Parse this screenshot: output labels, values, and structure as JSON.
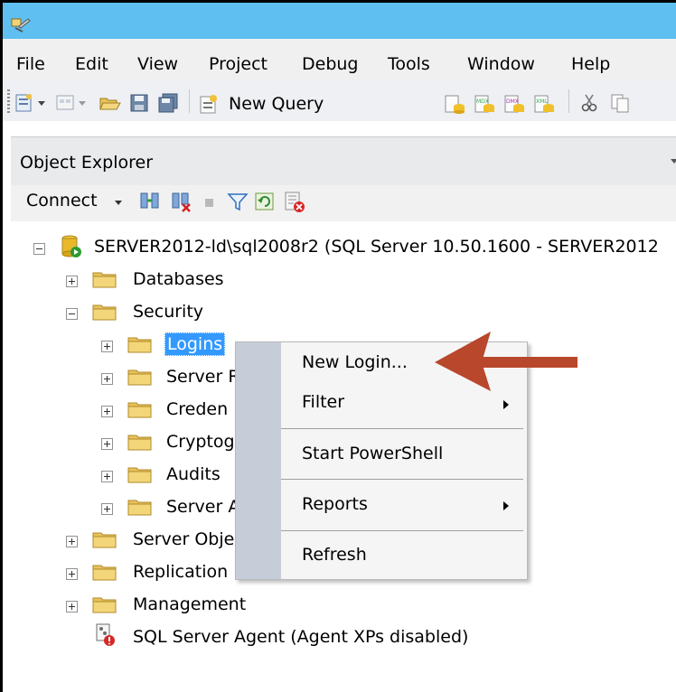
{
  "menu": [
    "File",
    "Edit",
    "View",
    "Project",
    "Debug",
    "Tools",
    "Window",
    "Help"
  ],
  "toolbar": {
    "new_query_label": "New Query"
  },
  "object_explorer": {
    "title": "Object Explorer",
    "connect_label": "Connect",
    "toolbar_icons": [
      "connect-icon",
      "disconnect-icon",
      "stop-icon",
      "filter-icon",
      "refresh-icon",
      "summary-icon"
    ]
  },
  "tree": {
    "server": "SERVER2012-ld\\sql2008r2 (SQL Server 10.50.1600 - SERVER2012",
    "databases": "Databases",
    "security": "Security",
    "logins": "Logins",
    "server_roles": "Server R",
    "credentials": "Creden",
    "cryptographic": "Cryptog",
    "audits": "Audits",
    "server_audit_specs": "Server A",
    "server_objects": "Server Obje",
    "replication": "Replication",
    "management": "Management",
    "sql_agent": "SQL Server Agent (Agent XPs disabled)"
  },
  "context_menu": {
    "new_login": "New Login...",
    "filter": "Filter",
    "start_powershell": "Start PowerShell",
    "reports": "Reports",
    "refresh": "Refresh"
  },
  "colors": {
    "titlebar": "#5ebff0",
    "selection": "#3399ff",
    "annotation_arrow": "#b8472b",
    "folder": "#e8c25a"
  }
}
